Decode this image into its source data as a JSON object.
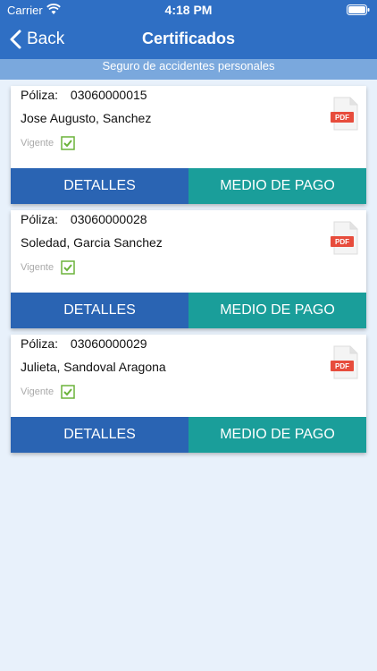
{
  "status_bar": {
    "carrier": "Carrier",
    "time": "4:18 PM"
  },
  "nav": {
    "back_label": "Back",
    "title": "Certificados"
  },
  "subtitle": "Seguro de accidentes personales",
  "cards": [
    {
      "policy_label": "Póliza:",
      "policy_number": "03060000015",
      "holder": "Jose Augusto, Sanchez",
      "status": "Vigente",
      "pdf_label": "PDF",
      "details_label": "DETALLES",
      "payment_label": "MEDIO DE PAGO"
    },
    {
      "policy_label": "Póliza:",
      "policy_number": "03060000028",
      "holder": "Soledad, Garcia Sanchez",
      "status": "Vigente",
      "pdf_label": "PDF",
      "details_label": "DETALLES",
      "payment_label": "MEDIO DE PAGO"
    },
    {
      "policy_label": "Póliza:",
      "policy_number": "03060000029",
      "holder": "Julieta, Sandoval Aragona",
      "status": "Vigente",
      "pdf_label": "PDF",
      "details_label": "DETALLES",
      "payment_label": "MEDIO DE PAGO"
    }
  ],
  "colors": {
    "header": "#2f6fc4",
    "subtitle_bar": "#7aa8dd",
    "details_button": "#2a64b3",
    "payment_button": "#1a9e9a",
    "background": "#e8f1fb"
  },
  "icons": {
    "back": "chevron-left-icon",
    "pdf": "pdf-file-icon",
    "status": "checkbox-checked-icon",
    "wifi": "wifi-icon",
    "battery": "battery-icon"
  }
}
